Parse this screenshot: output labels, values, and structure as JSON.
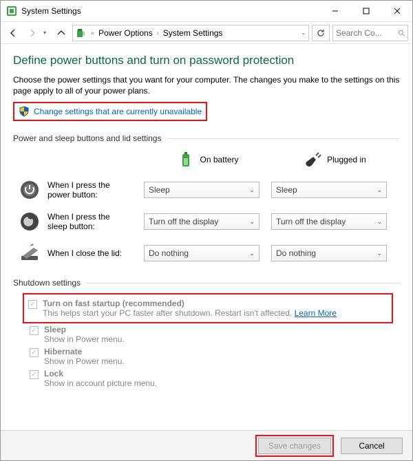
{
  "window": {
    "title": "System Settings"
  },
  "breadcrumb": {
    "l1": "Power Options",
    "l2": "System Settings"
  },
  "search": {
    "placeholder": "Search Co..."
  },
  "heading": "Define power buttons and turn on password protection",
  "intro": "Choose the power settings that you want for your computer. The changes you make to the settings on this page apply to all of your power plans.",
  "adminlink": "Change settings that are currently unavailable",
  "section1": "Power and sleep buttons and lid settings",
  "col": {
    "battery": "On battery",
    "plugged": "Plugged in"
  },
  "rows": {
    "power": {
      "label": "When I press the power button:",
      "battery": "Sleep",
      "plugged": "Sleep"
    },
    "sleep": {
      "label": "When I press the sleep button:",
      "battery": "Turn off the display",
      "plugged": "Turn off the display"
    },
    "lid": {
      "label": "When I close the lid:",
      "battery": "Do nothing",
      "plugged": "Do nothing"
    }
  },
  "section2": "Shutdown settings",
  "shutdown": {
    "fast": {
      "title": "Turn on fast startup (recommended)",
      "desc": "This helps start your PC faster after shutdown. Restart isn't affected.",
      "more": "Learn More"
    },
    "sleep": {
      "title": "Sleep",
      "desc": "Show in Power menu."
    },
    "hibernate": {
      "title": "Hibernate",
      "desc": "Show in Power menu."
    },
    "lock": {
      "title": "Lock",
      "desc": "Show in account picture menu."
    }
  },
  "buttons": {
    "save": "Save changes",
    "cancel": "Cancel"
  }
}
